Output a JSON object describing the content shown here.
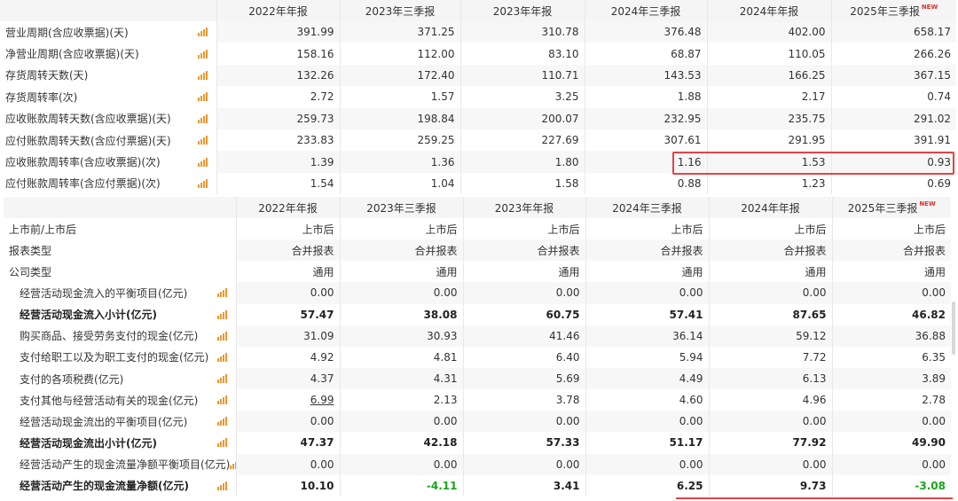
{
  "periods": [
    "2022年年报",
    "2023年三季报",
    "2023年年报",
    "2024年三季报",
    "2024年年报",
    "2025年三季报"
  ],
  "new_badge": "NEW",
  "turnover": {
    "rows": [
      {
        "label": "营业周期(含应收票据)(天)",
        "values": [
          "391.99",
          "371.25",
          "310.78",
          "376.48",
          "402.00",
          "658.17"
        ]
      },
      {
        "label": "净营业周期(含应收票据)(天)",
        "values": [
          "158.16",
          "112.00",
          "83.10",
          "68.87",
          "110.05",
          "266.26"
        ]
      },
      {
        "label": "存货周转天数(天)",
        "values": [
          "132.26",
          "172.40",
          "110.71",
          "143.53",
          "166.25",
          "367.15"
        ]
      },
      {
        "label": "存货周转率(次)",
        "values": [
          "2.72",
          "1.57",
          "3.25",
          "1.88",
          "2.17",
          "0.74"
        ]
      },
      {
        "label": "应收账款周转天数(含应收票据)(天)",
        "values": [
          "259.73",
          "198.84",
          "200.07",
          "232.95",
          "235.75",
          "291.02"
        ]
      },
      {
        "label": "应付账款周转天数(含应付票据)(天)",
        "values": [
          "233.83",
          "259.25",
          "227.69",
          "307.61",
          "291.95",
          "391.91"
        ]
      },
      {
        "label": "应收账款周转率(含应收票据)(次)",
        "values": [
          "1.39",
          "1.36",
          "1.80",
          "1.16",
          "1.53",
          "0.93"
        ]
      },
      {
        "label": "应付账款周转率(含应付票据)(次)",
        "values": [
          "1.54",
          "1.04",
          "1.58",
          "0.88",
          "1.23",
          "0.69"
        ]
      }
    ]
  },
  "cashflow": {
    "rows": [
      {
        "label": "上市前/上市后",
        "values": [
          "上市后",
          "上市后",
          "上市后",
          "上市后",
          "上市后",
          "上市后"
        ]
      },
      {
        "label": "报表类型",
        "values": [
          "合并报表",
          "合并报表",
          "合并报表",
          "合并报表",
          "合并报表",
          "合并报表"
        ]
      },
      {
        "label": "公司类型",
        "values": [
          "通用",
          "通用",
          "通用",
          "通用",
          "通用",
          "通用"
        ]
      },
      {
        "label": "经营活动现金流入的平衡项目(亿元)",
        "values": [
          "0.00",
          "0.00",
          "0.00",
          "0.00",
          "0.00",
          "0.00"
        ]
      },
      {
        "label": "经营活动现金流入小计(亿元)",
        "values": [
          "57.47",
          "38.08",
          "60.75",
          "57.41",
          "87.65",
          "46.82"
        ]
      },
      {
        "label": "购买商品、接受劳务支付的现金(亿元)",
        "values": [
          "31.09",
          "30.93",
          "41.46",
          "36.14",
          "59.12",
          "36.88"
        ]
      },
      {
        "label": "支付给职工以及为职工支付的现金(亿元)",
        "values": [
          "4.92",
          "4.81",
          "6.40",
          "5.94",
          "7.72",
          "6.35"
        ]
      },
      {
        "label": "支付的各项税费(亿元)",
        "values": [
          "4.37",
          "4.31",
          "5.69",
          "4.49",
          "6.13",
          "3.89"
        ]
      },
      {
        "label": "支付其他与经营活动有关的现金(亿元)",
        "values": [
          "6.99",
          "2.13",
          "3.78",
          "4.60",
          "4.96",
          "2.78"
        ]
      },
      {
        "label": "经营活动现金流出的平衡项目(亿元)",
        "values": [
          "0.00",
          "0.00",
          "0.00",
          "0.00",
          "0.00",
          "0.00"
        ]
      },
      {
        "label": "经营活动现金流出小计(亿元)",
        "values": [
          "47.37",
          "42.18",
          "57.33",
          "51.17",
          "77.92",
          "49.90"
        ]
      },
      {
        "label": "经营活动产生的现金流量净额平衡项目(亿元)",
        "values": [
          "0.00",
          "0.00",
          "0.00",
          "0.00",
          "0.00",
          "0.00"
        ]
      },
      {
        "label": "经营活动产生的现金流量净额(亿元)",
        "values": [
          "10.10",
          "-4.11",
          "3.41",
          "6.25",
          "9.73",
          "-3.08"
        ]
      }
    ]
  },
  "colors": {
    "accent": "#f0962d",
    "highlight": "#e0444a",
    "negative": "#1aa31a",
    "new_badge": "#e0302a"
  }
}
